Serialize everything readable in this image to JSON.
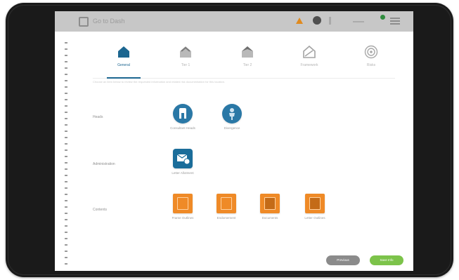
{
  "status_bar": {
    "title": "Go to Dash",
    "icons": [
      "app-logo-icon",
      "warning-icon",
      "user-icon",
      "info-icon",
      "sync-icon",
      "online-dot",
      "menu-icon"
    ],
    "colors": {
      "bar": "#c7c7c7",
      "warning": "#e08a1e",
      "online": "#2f8c3e"
    }
  },
  "tabs": [
    {
      "label": "General",
      "icon": "house-icon",
      "active": true
    },
    {
      "label": "Tier 1",
      "icon": "roof-icon",
      "active": false
    },
    {
      "label": "Tier 2",
      "icon": "roof-icon",
      "active": false
    },
    {
      "label": "Framework",
      "icon": "house-outline-icon",
      "active": false
    },
    {
      "label": "Risks",
      "icon": "target-icon",
      "active": false
    }
  ],
  "description": "Choose an item below to review the requested information and related risk documentation for this location.",
  "sections": [
    {
      "label": "Heads",
      "items": [
        {
          "label": "Consultant Heads",
          "icon": "person-badge-icon"
        },
        {
          "label": "Divergence",
          "icon": "person-icon"
        }
      ]
    },
    {
      "label": "Administration",
      "items": [
        {
          "label": "Letter Allotment",
          "icon": "mail-check-icon"
        }
      ]
    },
    {
      "label": "Contents",
      "items": [
        {
          "label": "Frame Outlines",
          "icon": "form-icon"
        },
        {
          "label": "Endorsement",
          "icon": "form-icon"
        },
        {
          "label": "Documents",
          "icon": "document-icon"
        },
        {
          "label": "Letter Outlines",
          "icon": "document-icon"
        }
      ]
    }
  ],
  "buttons": {
    "secondary": "Previous",
    "primary": "Save Info"
  },
  "colors": {
    "accent": "#1c6690",
    "orange": "#ef8a27",
    "green": "#7cc34a"
  }
}
